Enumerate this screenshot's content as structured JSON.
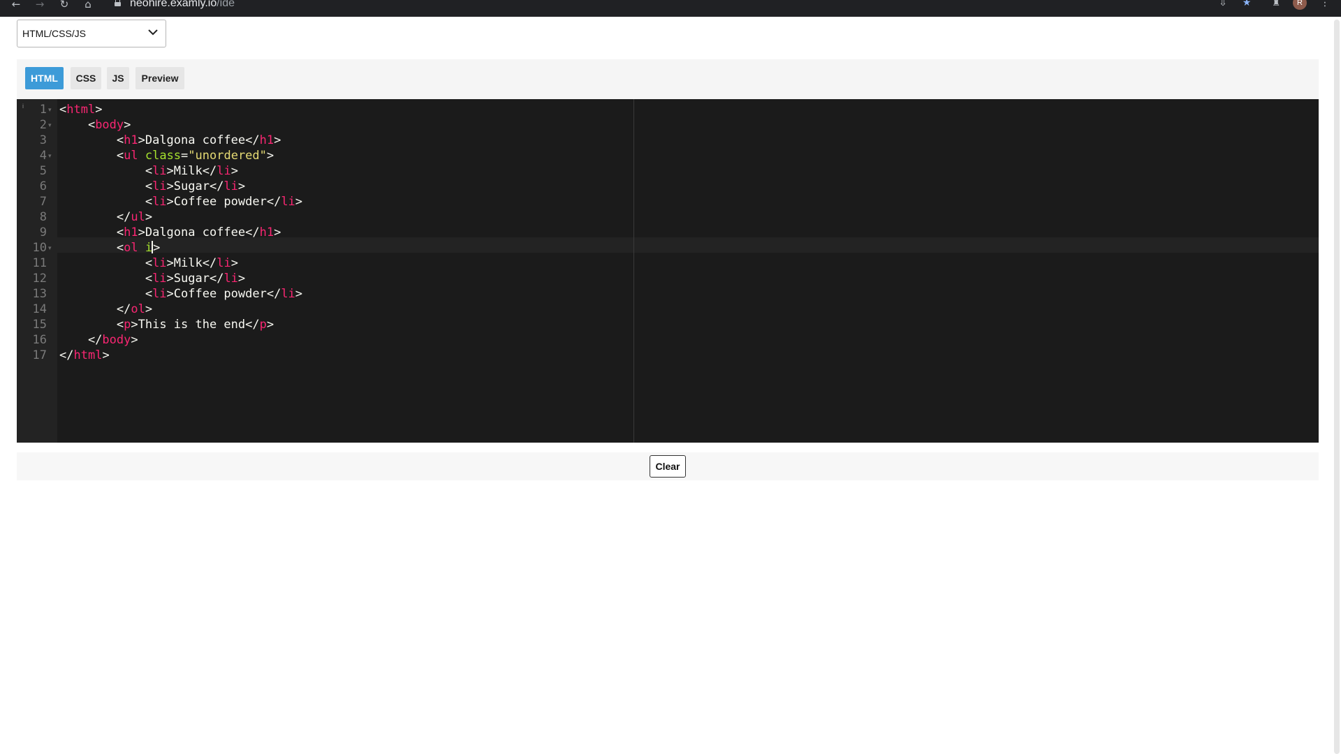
{
  "browser": {
    "url_host": "neohire.examly.io",
    "url_path": "/ide",
    "avatar_initial": "R",
    "icons": [
      "back-arrow-icon",
      "forward-arrow-icon",
      "reload-icon",
      "home-icon",
      "lock-icon",
      "install-app-icon",
      "bookmark-star-icon",
      "extensions-puzzle-icon",
      "kebab-menu-icon"
    ]
  },
  "language_select": {
    "value": "HTML/CSS/JS",
    "icon": "chevron-down-icon"
  },
  "tabs": [
    "HTML",
    "CSS",
    "JS",
    "Preview"
  ],
  "active_tab": "HTML",
  "editor": {
    "line_numbers": [
      "1",
      "2",
      "3",
      "4",
      "5",
      "6",
      "7",
      "8",
      "9",
      "10",
      "11",
      "12",
      "13",
      "14",
      "15",
      "16",
      "17"
    ],
    "lines": [
      [
        [
          "p",
          "<"
        ],
        [
          "t",
          "html"
        ],
        [
          "p",
          ">"
        ]
      ],
      [
        [
          "p",
          "    <"
        ],
        [
          "t",
          "body"
        ],
        [
          "p",
          ">"
        ]
      ],
      [
        [
          "p",
          "        <"
        ],
        [
          "t",
          "h1"
        ],
        [
          "p",
          ">Dalgona coffee</"
        ],
        [
          "t",
          "h1"
        ],
        [
          "p",
          ">"
        ]
      ],
      [
        [
          "p",
          "        <"
        ],
        [
          "t",
          "ul"
        ],
        [
          "p",
          " "
        ],
        [
          "a",
          "class"
        ],
        [
          "p",
          "="
        ],
        [
          "s",
          "\"unordered\""
        ],
        [
          "p",
          ">"
        ]
      ],
      [
        [
          "p",
          "            <"
        ],
        [
          "t",
          "li"
        ],
        [
          "p",
          ">Milk</"
        ],
        [
          "t",
          "li"
        ],
        [
          "p",
          ">"
        ]
      ],
      [
        [
          "p",
          "            <"
        ],
        [
          "t",
          "li"
        ],
        [
          "p",
          ">Sugar</"
        ],
        [
          "t",
          "li"
        ],
        [
          "p",
          ">"
        ]
      ],
      [
        [
          "p",
          "            <"
        ],
        [
          "t",
          "li"
        ],
        [
          "p",
          ">Coffee powder</"
        ],
        [
          "t",
          "li"
        ],
        [
          "p",
          ">"
        ]
      ],
      [
        [
          "p",
          "        </"
        ],
        [
          "t",
          "ul"
        ],
        [
          "p",
          ">"
        ]
      ],
      [
        [
          "p",
          "        <"
        ],
        [
          "t",
          "h1"
        ],
        [
          "p",
          ">Dalgona coffee</"
        ],
        [
          "t",
          "h1"
        ],
        [
          "p",
          ">"
        ]
      ],
      [
        [
          "p",
          "        <"
        ],
        [
          "t",
          "ol"
        ],
        [
          "p",
          " "
        ],
        [
          "a",
          "i"
        ],
        [
          "c",
          ""
        ],
        [
          "p",
          ">"
        ]
      ],
      [
        [
          "p",
          "            <"
        ],
        [
          "t",
          "li"
        ],
        [
          "p",
          ">Milk</"
        ],
        [
          "t",
          "li"
        ],
        [
          "p",
          ">"
        ]
      ],
      [
        [
          "p",
          "            <"
        ],
        [
          "t",
          "li"
        ],
        [
          "p",
          ">Sugar</"
        ],
        [
          "t",
          "li"
        ],
        [
          "p",
          ">"
        ]
      ],
      [
        [
          "p",
          "            <"
        ],
        [
          "t",
          "li"
        ],
        [
          "p",
          ">Coffee powder</"
        ],
        [
          "t",
          "li"
        ],
        [
          "p",
          ">"
        ]
      ],
      [
        [
          "p",
          "        </"
        ],
        [
          "t",
          "ol"
        ],
        [
          "p",
          ">"
        ]
      ],
      [
        [
          "p",
          "        <"
        ],
        [
          "t",
          "p"
        ],
        [
          "p",
          ">This is the end</"
        ],
        [
          "t",
          "p"
        ],
        [
          "p",
          ">"
        ]
      ],
      [
        [
          "p",
          "    </"
        ],
        [
          "t",
          "body"
        ],
        [
          "p",
          ">"
        ]
      ],
      [
        [
          "p",
          "</"
        ],
        [
          "t",
          "html"
        ],
        [
          "p",
          ">"
        ]
      ]
    ],
    "foldable_lines": [
      1,
      2,
      4,
      10
    ],
    "active_line": 10,
    "colors": {
      "background": "#1b1b1b",
      "tag": "#f92672",
      "attribute": "#a6e22e",
      "string": "#e6db74",
      "text": "#f8f8f2"
    }
  },
  "footer": {
    "clear_label": "Clear"
  },
  "accent_color": "#3d9bd8"
}
